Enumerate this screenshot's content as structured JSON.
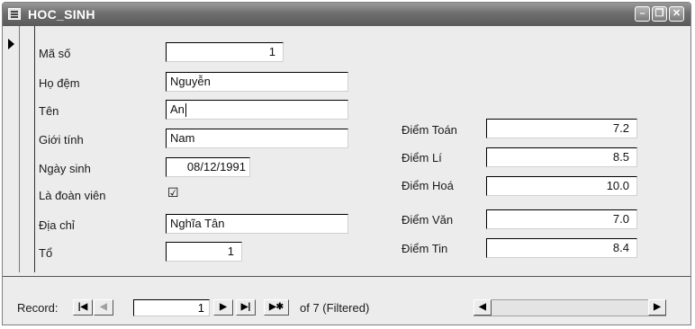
{
  "window": {
    "title": "HOC_SINH"
  },
  "form": {
    "fields": {
      "ma_so": {
        "label": "Mã số",
        "value": "1"
      },
      "ho_dem": {
        "label": "Họ đệm",
        "value": "Nguyễn"
      },
      "ten": {
        "label": "Tên",
        "value": "An"
      },
      "gioi_tinh": {
        "label": "Giới tính",
        "value": "Nam"
      },
      "ngay_sinh": {
        "label": "Ngày sinh",
        "value": "08/12/1991"
      },
      "doan_vien": {
        "label": "Là đoàn viên",
        "checked": true,
        "mark": "☑"
      },
      "dia_chi": {
        "label": "Địa chỉ",
        "value": "Nghĩa Tân"
      },
      "to": {
        "label": "Tổ",
        "value": "1"
      }
    },
    "scores": {
      "toan": {
        "label": "Điểm Toán",
        "value": "7.2"
      },
      "li": {
        "label": "Điểm Lí",
        "value": "8.5"
      },
      "hoa": {
        "label": "Điểm Hoá",
        "value": "10.0"
      },
      "van": {
        "label": "Điểm Văn",
        "value": "7.0"
      },
      "tin": {
        "label": "Điểm Tin",
        "value": "8.4"
      }
    }
  },
  "navigation": {
    "record_label": "Record:",
    "current": "1",
    "total_text": "of  7 (Filtered)",
    "first_glyph": "|◀",
    "prev_glyph": "◀",
    "next_glyph": "▶",
    "last_glyph": "▶|",
    "new_glyph": "▶✱",
    "scroll_left": "◀",
    "scroll_right": "▶"
  },
  "icons": {
    "minimize": "–",
    "restore": "❐",
    "close": "✕"
  }
}
